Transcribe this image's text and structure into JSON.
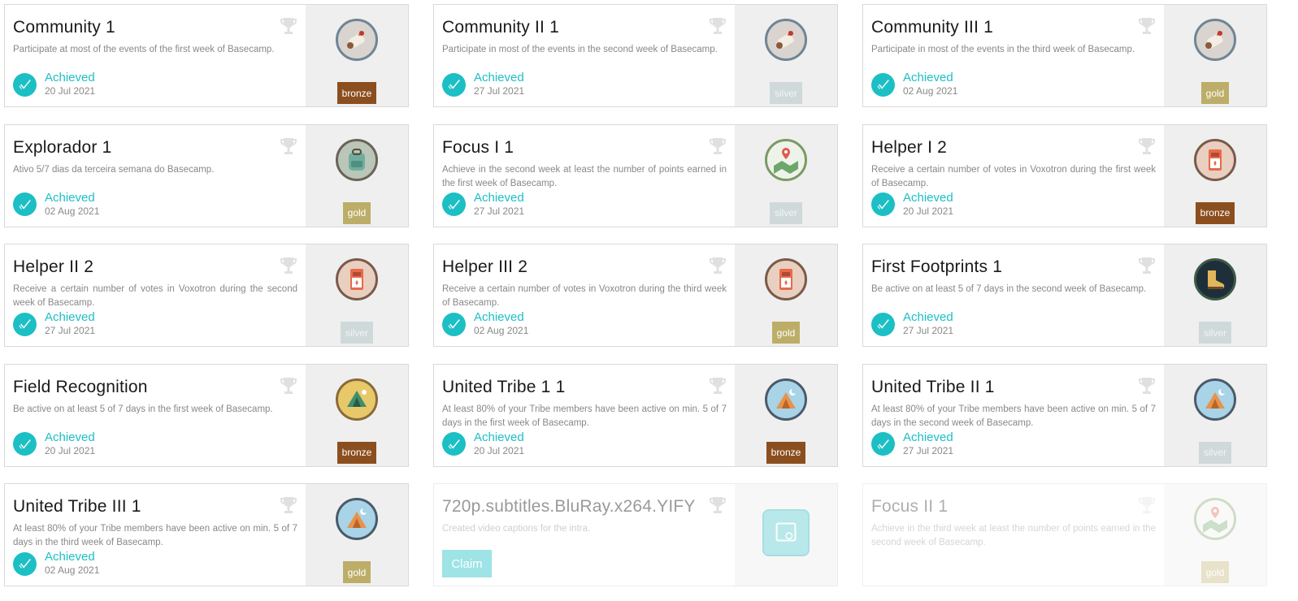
{
  "trophy_icon": "trophy-icon",
  "check_icon": "check-icon",
  "colors": {
    "accent": "#1cbfc4",
    "bronze": "#8b4f1f",
    "silver": "#cfd9da",
    "gold": "#bcae68"
  },
  "cards": [
    {
      "title": "Community 1",
      "desc": "Participate at most of the events of the first week of Basecamp.",
      "status": "Achieved",
      "date": "20 Jul 2021",
      "tier": "bronze",
      "icon": "scroll-icon",
      "state": "achieved"
    },
    {
      "title": "Community II 1",
      "desc": "Participate in most of the events in the second week of Basecamp.",
      "status": "Achieved",
      "date": "27 Jul 2021",
      "tier": "silver",
      "icon": "scroll-icon",
      "state": "achieved"
    },
    {
      "title": "Community III 1",
      "desc": "Participate in most of the events in the third week of Basecamp.",
      "status": "Achieved",
      "date": "02 Aug 2021",
      "tier": "gold",
      "icon": "scroll-icon",
      "state": "achieved"
    },
    {
      "title": "Explorador 1",
      "desc": "Ativo 5/7 dias da terceira semana do Basecamp.",
      "status": "Achieved",
      "date": "02 Aug 2021",
      "tier": "gold",
      "icon": "backpack-icon",
      "state": "achieved"
    },
    {
      "title": "Focus I 1",
      "desc": "Achieve in the second week at least the number of points earned in the first week of Basecamp.",
      "status": "Achieved",
      "date": "27 Jul 2021",
      "tier": "silver",
      "icon": "map-pin-icon",
      "state": "achieved"
    },
    {
      "title": "Helper I 2",
      "desc": "Receive a certain number of votes in Voxotron during the first week of Basecamp.",
      "status": "Achieved",
      "date": "20 Jul 2021",
      "tier": "bronze",
      "icon": "matchbox-icon",
      "state": "achieved"
    },
    {
      "title": "Helper II 2",
      "desc": "Receive a certain number of votes in Voxotron during the second week of Basecamp.",
      "status": "Achieved",
      "date": "27 Jul 2021",
      "tier": "silver",
      "icon": "matchbox-icon",
      "state": "achieved"
    },
    {
      "title": "Helper III 2",
      "desc": "Receive a certain number of votes in Voxotron during the third week of Basecamp.",
      "status": "Achieved",
      "date": "02 Aug 2021",
      "tier": "gold",
      "icon": "matchbox-icon",
      "state": "achieved"
    },
    {
      "title": "First Footprints 1",
      "desc": "Be active on at least 5 of 7 days in the second week of Basecamp.",
      "status": "Achieved",
      "date": "27 Jul 2021",
      "tier": "silver",
      "icon": "boot-icon",
      "state": "achieved"
    },
    {
      "title": "Field Recognition",
      "desc": "Be active on at least 5 of 7 days in the first week of Basecamp.",
      "status": "Achieved",
      "date": "20 Jul 2021",
      "tier": "bronze",
      "icon": "tent-icon",
      "state": "achieved"
    },
    {
      "title": "United Tribe 1 1",
      "desc": "At least 80% of your Tribe members have been active on min. 5 of 7 days in the first week of Basecamp.",
      "status": "Achieved",
      "date": "20 Jul 2021",
      "tier": "bronze",
      "icon": "tent-night-icon",
      "state": "achieved"
    },
    {
      "title": "United Tribe II 1",
      "desc": "At least 80% of your Tribe members have been active on min. 5 of 7 days in the second week of Basecamp.",
      "status": "Achieved",
      "date": "27 Jul 2021",
      "tier": "silver",
      "icon": "tent-night-icon",
      "state": "achieved"
    },
    {
      "title": "United Tribe III 1",
      "desc": "At least 80% of your Tribe members have been active on min. 5 of 7 days in the third week of Basecamp.",
      "status": "Achieved",
      "date": "02 Aug 2021",
      "tier": "gold",
      "icon": "tent-night-icon",
      "state": "achieved"
    },
    {
      "title": "720p.subtitles.BluRay.x264.YIFY",
      "desc": "Created video captions for the intra.",
      "claim_label": "Claim",
      "icon": "video-caption-icon",
      "state": "claimable"
    },
    {
      "title": "Focus II 1",
      "desc": "Achieve in the third week at least the number of points earned in the second week of Basecamp.",
      "tier": "gold",
      "icon": "map-pin-icon",
      "state": "locked"
    }
  ]
}
